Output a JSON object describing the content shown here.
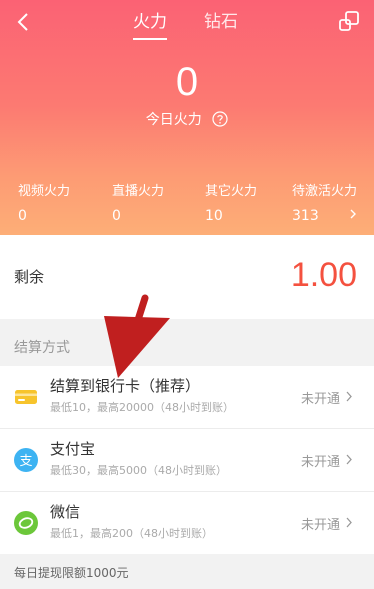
{
  "header": {
    "tabs": [
      {
        "label": "火力",
        "active": true
      },
      {
        "label": "钻石",
        "active": false
      }
    ],
    "today_value": "0",
    "today_label": "今日火力"
  },
  "stats": [
    {
      "label": "视频火力",
      "value": "0"
    },
    {
      "label": "直播火力",
      "value": "0"
    },
    {
      "label": "其它火力",
      "value": "10"
    },
    {
      "label": "待激活火力",
      "value": "313"
    }
  ],
  "remain": {
    "label": "剩余",
    "value": "1.00"
  },
  "section_title": "结算方式",
  "methods": [
    {
      "name": "结算到银行卡（推荐）",
      "desc": "最低10，最高20000（48小时到账）",
      "status": "未开通",
      "icon": "bank-card-icon"
    },
    {
      "name": "支付宝",
      "desc": "最低30，最高5000（48小时到账）",
      "status": "未开通",
      "icon": "alipay-icon"
    },
    {
      "name": "微信",
      "desc": "最低1，最高200（48小时到账）",
      "status": "未开通",
      "icon": "wechat-icon"
    }
  ],
  "footer": {
    "note": "每日提现限额1000元"
  },
  "colors": {
    "accent": "#f4513f",
    "hero_top": "#fb6274",
    "hero_bottom": "#fdae77",
    "annotation_arrow": "#c01f1f"
  }
}
